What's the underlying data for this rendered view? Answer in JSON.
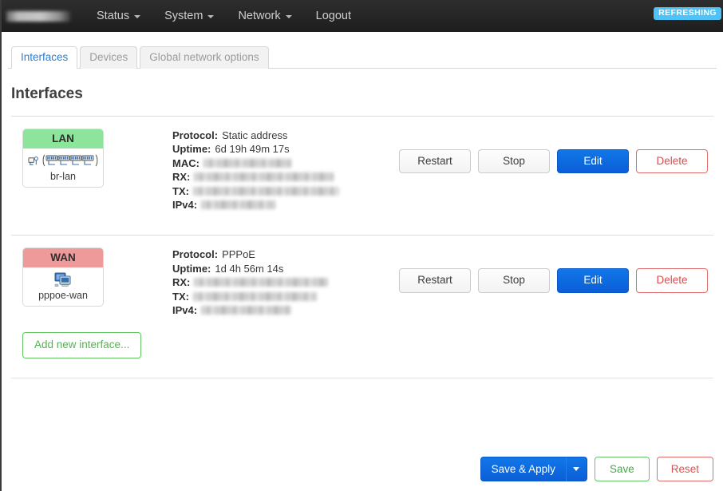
{
  "navbar": {
    "brand_label": "",
    "items": [
      {
        "label": "Status",
        "has_caret": true
      },
      {
        "label": "System",
        "has_caret": true
      },
      {
        "label": "Network",
        "has_caret": true
      },
      {
        "label": "Logout",
        "has_caret": false
      }
    ],
    "status_badge": "REFRESHING",
    "badge_color": "#4ec3f7"
  },
  "tabs": [
    {
      "label": "Interfaces",
      "active": true
    },
    {
      "label": "Devices",
      "active": false
    },
    {
      "label": "Global network options",
      "active": false
    }
  ],
  "page": {
    "title": "Interfaces"
  },
  "interfaces": [
    {
      "name": "LAN",
      "header_color": "#8ce59a",
      "device": "br-lan",
      "icon": "switch-ports-icon",
      "info": [
        {
          "key": "Protocol:",
          "value": "Static address",
          "redacted": false
        },
        {
          "key": "Uptime:",
          "value": "6d 19h 49m 17s",
          "redacted": false
        },
        {
          "key": "MAC:",
          "value": "",
          "redacted": true,
          "redact_width": 110
        },
        {
          "key": "RX:",
          "value": "",
          "redacted": true,
          "redact_width": 175
        },
        {
          "key": "TX:",
          "value": "",
          "redacted": true,
          "redact_width": 183
        },
        {
          "key": "IPv4:",
          "value": "",
          "redacted": true,
          "redact_width": 93
        }
      ],
      "actions": [
        {
          "label": "Restart",
          "style": "neutral"
        },
        {
          "label": "Stop",
          "style": "neutral"
        },
        {
          "label": "Edit",
          "style": "primary"
        },
        {
          "label": "Delete",
          "style": "danger"
        }
      ]
    },
    {
      "name": "WAN",
      "header_color": "#ef9a9a",
      "device": "pppoe-wan",
      "icon": "network-adapter-icon",
      "info": [
        {
          "key": "Protocol:",
          "value": "PPPoE",
          "redacted": false
        },
        {
          "key": "Uptime:",
          "value": "1d 4h 56m 14s",
          "redacted": false
        },
        {
          "key": "RX:",
          "value": "",
          "redacted": true,
          "redact_width": 168
        },
        {
          "key": "TX:",
          "value": "",
          "redacted": true,
          "redact_width": 155
        },
        {
          "key": "IPv4:",
          "value": "",
          "redacted": true,
          "redact_width": 113
        }
      ],
      "actions": [
        {
          "label": "Restart",
          "style": "neutral"
        },
        {
          "label": "Stop",
          "style": "neutral"
        },
        {
          "label": "Edit",
          "style": "primary"
        },
        {
          "label": "Delete",
          "style": "danger"
        }
      ]
    }
  ],
  "add_interface_label": "Add new interface...",
  "footer": {
    "save_apply_label": "Save & Apply",
    "save_label": "Save",
    "reset_label": "Reset"
  }
}
